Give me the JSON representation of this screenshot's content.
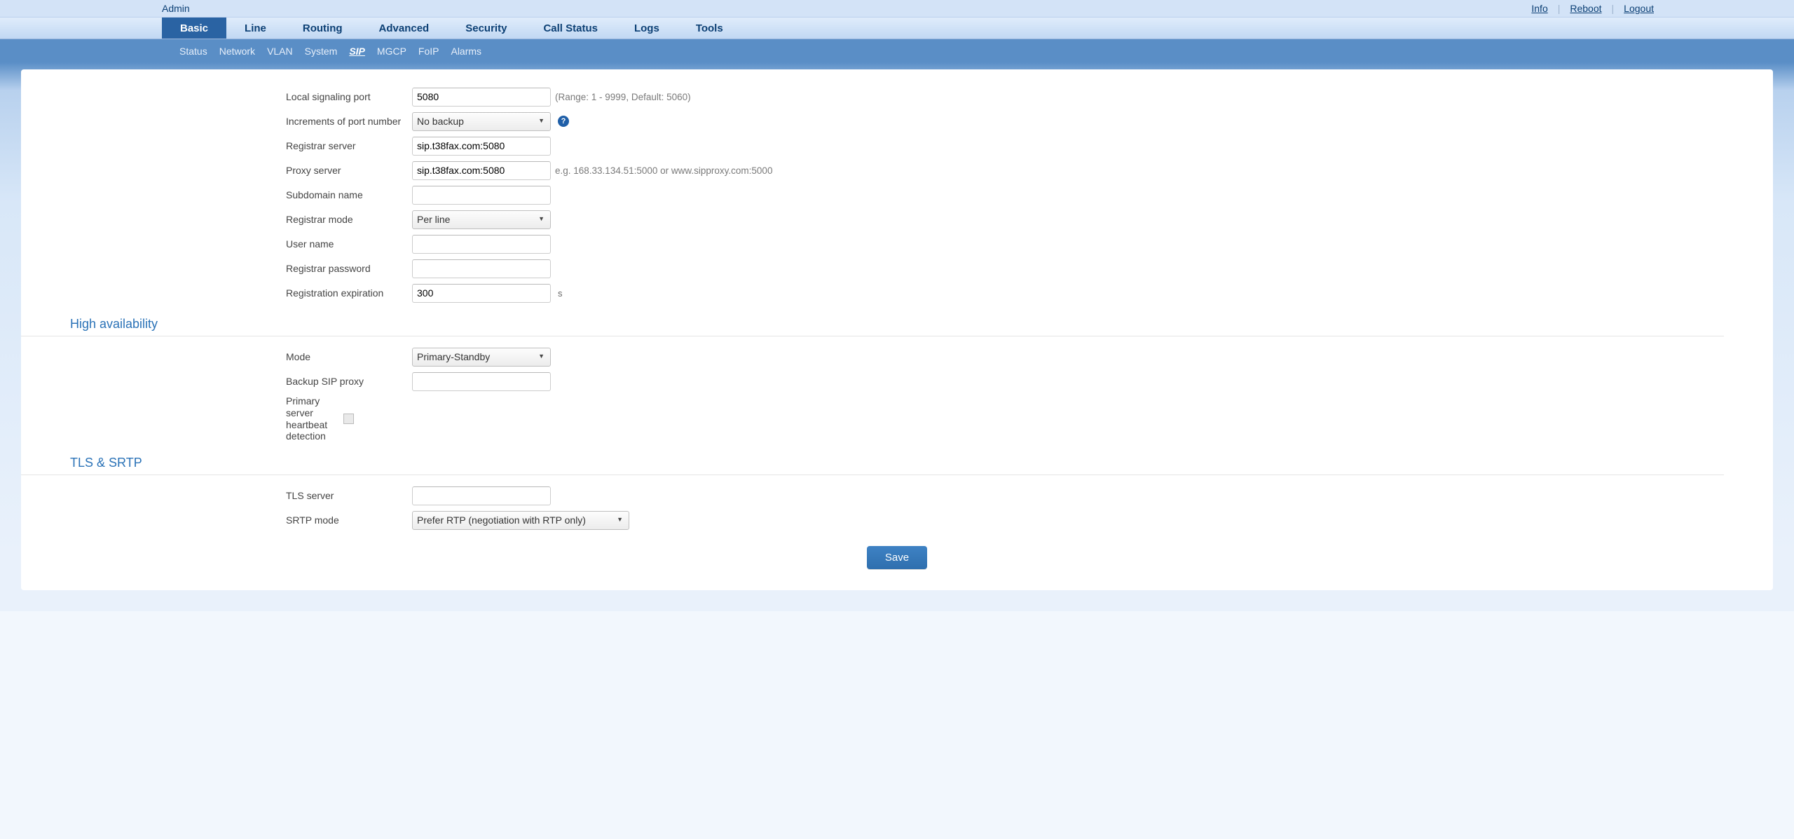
{
  "topbar": {
    "admin": "Admin",
    "info": "Info",
    "reboot": "Reboot",
    "logout": "Logout"
  },
  "mainTabs": [
    "Basic",
    "Line",
    "Routing",
    "Advanced",
    "Security",
    "Call Status",
    "Logs",
    "Tools"
  ],
  "mainActive": 0,
  "subTabs": [
    "Status",
    "Network",
    "VLAN",
    "System",
    "SIP",
    "MGCP",
    "FoIP",
    "Alarms"
  ],
  "subActive": 4,
  "fields": {
    "localPort": {
      "label": "Local signaling port",
      "value": "5080",
      "hint": "(Range: 1 - 9999, Default: 5060)"
    },
    "increments": {
      "label": "Increments of port number",
      "value": "No backup"
    },
    "registrar": {
      "label": "Registrar server",
      "value": "sip.t38fax.com:5080"
    },
    "proxy": {
      "label": "Proxy server",
      "value": "sip.t38fax.com:5080",
      "hint": "e.g. 168.33.134.51:5000 or www.sipproxy.com:5000"
    },
    "subdomain": {
      "label": "Subdomain name",
      "value": ""
    },
    "registrarMode": {
      "label": "Registrar mode",
      "value": "Per line"
    },
    "userName": {
      "label": "User name",
      "value": ""
    },
    "registrarPass": {
      "label": "Registrar password",
      "value": ""
    },
    "regExpire": {
      "label": "Registration expiration",
      "value": "300",
      "unit": "s"
    }
  },
  "sections": {
    "ha": "High availability",
    "tls": "TLS & SRTP"
  },
  "ha": {
    "mode": {
      "label": "Mode",
      "value": "Primary-Standby"
    },
    "backupProxy": {
      "label": "Backup SIP proxy",
      "value": ""
    },
    "heartbeat": {
      "label": "Primary server heartbeat detection"
    }
  },
  "tls": {
    "server": {
      "label": "TLS server",
      "value": ""
    },
    "srtpMode": {
      "label": "SRTP mode",
      "value": "Prefer RTP (negotiation with RTP only)"
    }
  },
  "saveButton": "Save",
  "helpGlyph": "?"
}
